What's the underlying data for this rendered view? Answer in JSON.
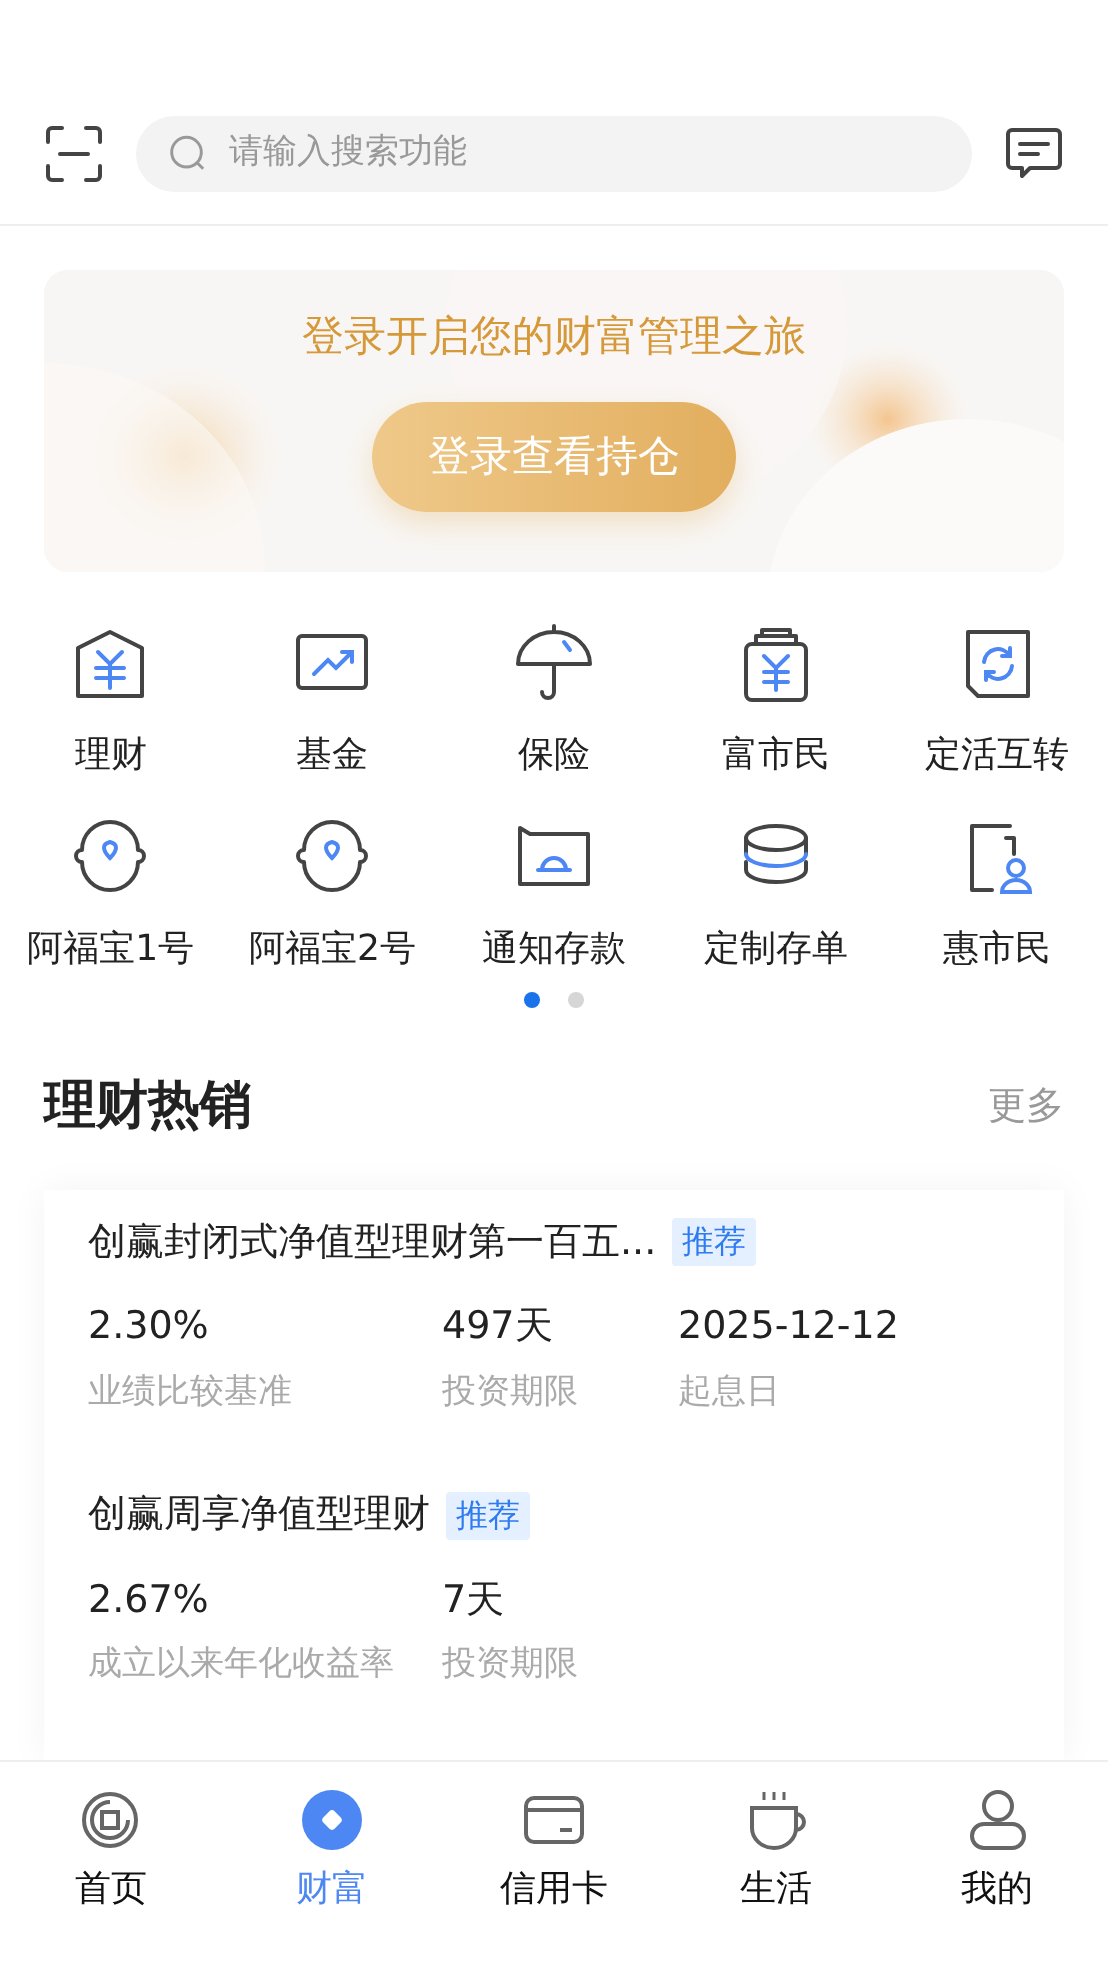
{
  "header": {
    "search": {
      "placeholder": "请输入搜索功能"
    }
  },
  "banner": {
    "title": "登录开启您的财富管理之旅",
    "button": "登录查看持仓"
  },
  "shortcuts": [
    {
      "kind": "house",
      "label": "理财"
    },
    {
      "kind": "chart",
      "label": "基金"
    },
    {
      "kind": "umbrella",
      "label": "保险"
    },
    {
      "kind": "bag",
      "label": "富市民"
    },
    {
      "kind": "cycle",
      "label": "定活互转"
    },
    {
      "kind": "pin",
      "label": "阿福宝1号"
    },
    {
      "kind": "pin",
      "label": "阿福宝2号"
    },
    {
      "kind": "folder",
      "label": "通知存款"
    },
    {
      "kind": "coins",
      "label": "定制存单"
    },
    {
      "kind": "person",
      "label": "惠市民"
    }
  ],
  "pager": [
    {
      "selected": true
    },
    {
      "selected": false
    }
  ],
  "section": {
    "title": "理财热销",
    "more": "更多"
  },
  "products": [
    {
      "title": "创赢封闭式净值型理财第一百五...",
      "tag": "推荐",
      "metrics": [
        {
          "value": "2.30%",
          "label": "业绩比较基准"
        },
        {
          "value": "497天",
          "label": "投资期限"
        },
        {
          "value": "2025-12-12",
          "label": "起息日"
        }
      ]
    },
    {
      "title": "创赢周享净值型理财",
      "tag": "推荐",
      "metrics": [
        {
          "value": "2.67%",
          "label": "成立以来年化收益率"
        },
        {
          "value": "7天",
          "label": "投资期限"
        }
      ]
    }
  ],
  "tabs": [
    {
      "kind": "home",
      "label": "首页",
      "selected": false
    },
    {
      "kind": "wealth",
      "label": "财富",
      "selected": true
    },
    {
      "kind": "card",
      "label": "信用卡",
      "selected": false
    },
    {
      "kind": "cup",
      "label": "生活",
      "selected": false
    },
    {
      "kind": "user",
      "label": "我的",
      "selected": false
    }
  ]
}
